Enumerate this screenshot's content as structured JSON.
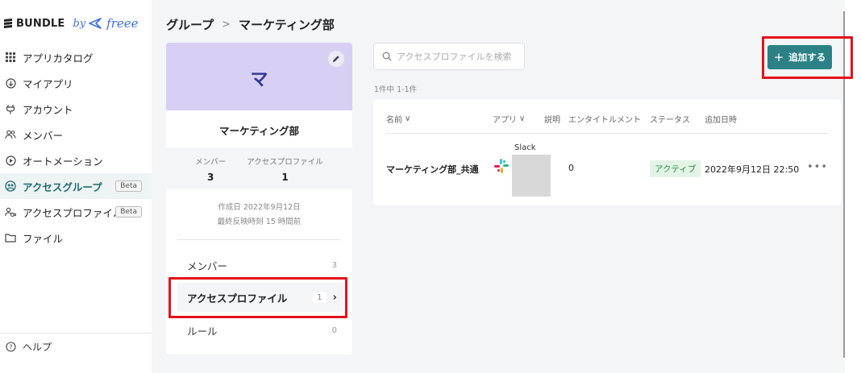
{
  "logo": {
    "brand": "BUNDLE",
    "by": "by",
    "partner": "freee"
  },
  "sidebar": {
    "items": [
      {
        "label": "アプリカタログ",
        "icon": "grid-icon"
      },
      {
        "label": "マイアプリ",
        "icon": "app-circle-icon"
      },
      {
        "label": "アカウント",
        "icon": "plug-icon"
      },
      {
        "label": "メンバー",
        "icon": "members-icon"
      },
      {
        "label": "オートメーション",
        "icon": "play-circle-icon"
      },
      {
        "label": "アクセスグループ",
        "icon": "access-group-icon",
        "badge": "Beta",
        "active": true
      },
      {
        "label": "アクセスプロファイル",
        "icon": "access-profile-icon",
        "badge": "Beta"
      },
      {
        "label": "ファイル",
        "icon": "folder-icon"
      }
    ],
    "help": "ヘルプ"
  },
  "breadcrumb": {
    "parent": "グループ",
    "current": "マーケティング部"
  },
  "group_card": {
    "initial": "マ",
    "name": "マーケティング部",
    "stats": [
      {
        "label": "メンバー",
        "value": "3"
      },
      {
        "label": "アクセスプロファイル",
        "value": "1"
      }
    ],
    "created": "作成日 2022年9月12日",
    "last_sync": "最終反映時刻 15 時間前",
    "rows": [
      {
        "label": "メンバー",
        "count": "3"
      },
      {
        "label": "アクセスプロファイル",
        "count": "1"
      },
      {
        "label": "ルール",
        "count": "0"
      }
    ]
  },
  "search": {
    "placeholder": "アクセスプロファイルを検索"
  },
  "result_count": "1件中 1-1件",
  "add_button": {
    "label": "追加する"
  },
  "table": {
    "headers": [
      "名前",
      "アプリ",
      "説明",
      "エンタイトルメント",
      "ステータス",
      "追加日時"
    ],
    "rows": [
      {
        "name": "マーケティング部_共通",
        "app": "Slack",
        "description": "",
        "entitlement": "0",
        "status": "アクティブ",
        "added": "2022年9月12日 22:50"
      }
    ]
  },
  "colors": {
    "accent": "#2b8186",
    "banner": "#d8cff4",
    "highlight": "#e3131a"
  }
}
